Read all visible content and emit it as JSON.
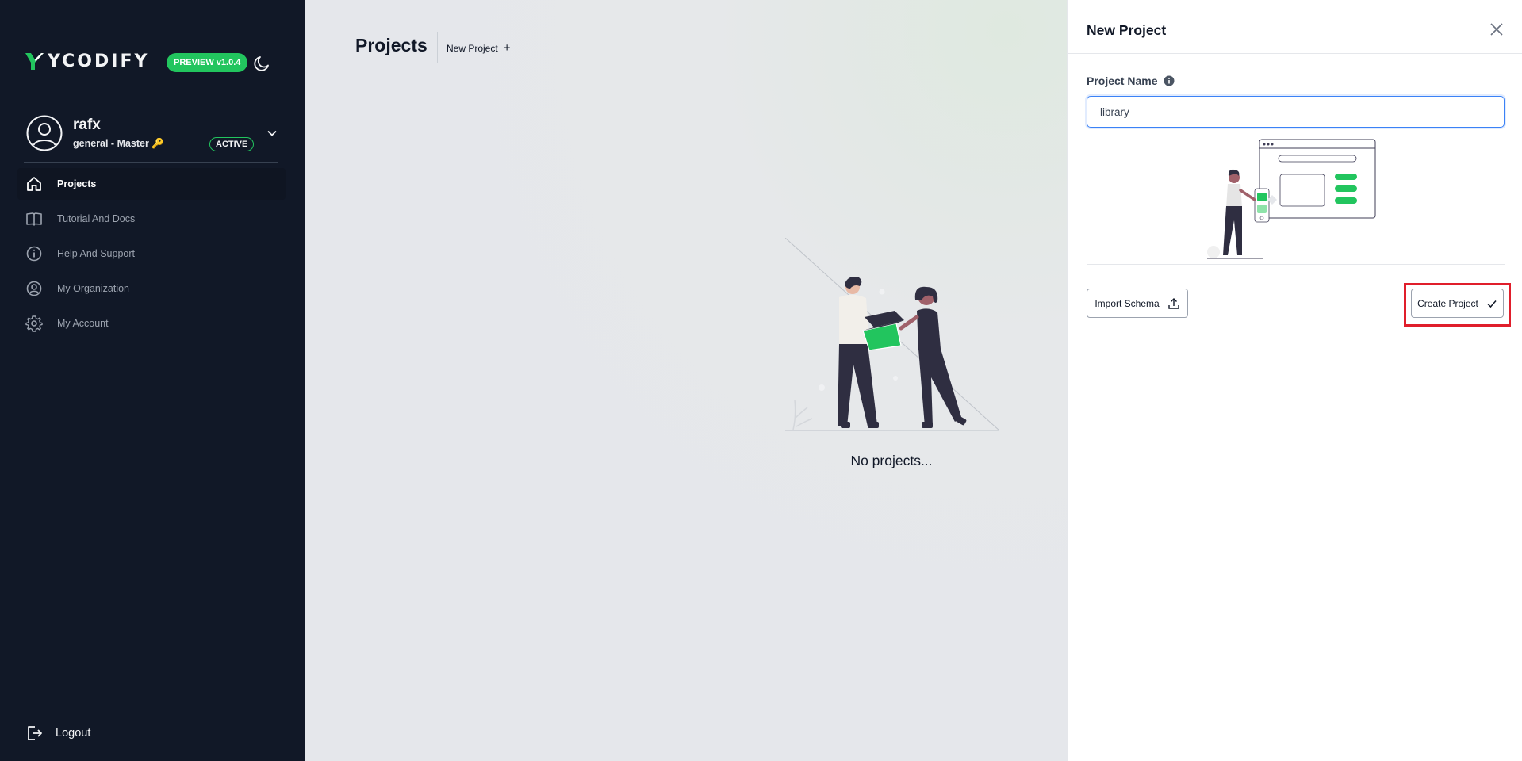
{
  "brand": {
    "logo_text": "YCODIFY",
    "version_badge": "PREVIEW v1.0.4",
    "accent_color": "#22c55e"
  },
  "user": {
    "name": "rafx",
    "role": "general - Master 🔑",
    "status": "ACTIVE"
  },
  "sidebar": {
    "items": [
      {
        "label": "Projects",
        "icon": "home-icon",
        "active": true
      },
      {
        "label": "Tutorial And Docs",
        "icon": "book-icon",
        "active": false
      },
      {
        "label": "Help And Support",
        "icon": "info-circle-icon",
        "active": false
      },
      {
        "label": "My Organization",
        "icon": "user-circle-icon",
        "active": false
      },
      {
        "label": "My Account",
        "icon": "gear-icon",
        "active": false
      }
    ],
    "logout_label": "Logout"
  },
  "main": {
    "title": "Projects",
    "new_project_label": "New Project",
    "new_project_icon": "plus-icon",
    "empty_text": "No projects..."
  },
  "drawer": {
    "title": "New Project",
    "field_label": "Project Name",
    "field_value": "library",
    "import_label": "Import Schema",
    "create_label": "Create Project"
  }
}
